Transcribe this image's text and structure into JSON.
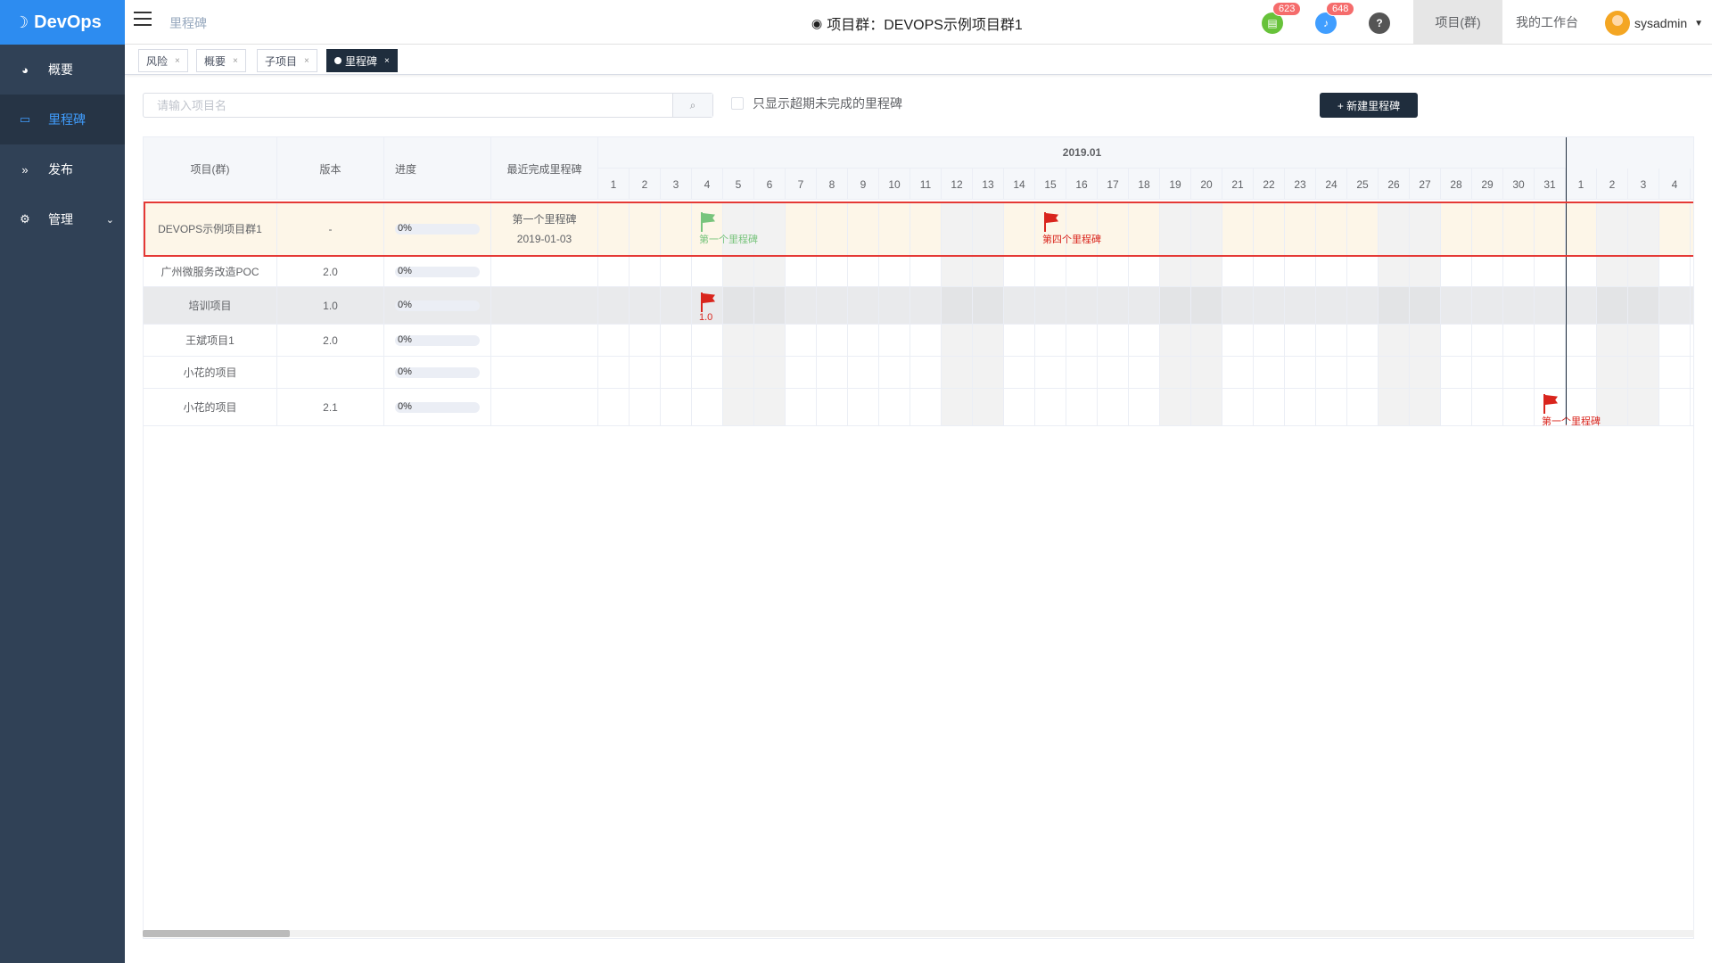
{
  "app": {
    "logo": "DevOps",
    "breadcrumb": "里程碑",
    "title": "项目群：DEVOPS示例项目群1",
    "user": "sysadmin"
  },
  "sidebar": {
    "items": [
      {
        "label": "概要",
        "icon": "dashboard-icon"
      },
      {
        "label": "里程碑",
        "icon": "folder-icon"
      },
      {
        "label": "发布",
        "icon": "forward-icon"
      },
      {
        "label": "管理",
        "icon": "gear-icon"
      }
    ]
  },
  "topbar": {
    "badge_tasks": "623",
    "badge_notify": "648",
    "nav_projects": "项目(群)",
    "nav_workspace": "我的工作台"
  },
  "tabs": [
    {
      "label": "风险"
    },
    {
      "label": "概要"
    },
    {
      "label": "子项目"
    },
    {
      "label": "里程碑"
    }
  ],
  "toolbar": {
    "search_placeholder": "请输入项目名",
    "overdue_only": "只显示超期未完成的里程碑",
    "new_button": "+ 新建里程碑"
  },
  "grid": {
    "headers": {
      "project": "项目(群)",
      "version": "版本",
      "progress": "进度",
      "latest": "最近完成里程碑"
    },
    "month": "2019.01",
    "days": [
      "1",
      "2",
      "3",
      "4",
      "5",
      "6",
      "7",
      "8",
      "9",
      "10",
      "11",
      "12",
      "13",
      "14",
      "15",
      "16",
      "17",
      "18",
      "19",
      "20",
      "21",
      "22",
      "23",
      "24",
      "25",
      "26",
      "27",
      "28",
      "29",
      "30",
      "31",
      "1",
      "2",
      "3",
      "4"
    ],
    "rows": [
      {
        "project": "DEVOPS示例项目群1",
        "version": "-",
        "progress": "0%",
        "latest_name": "第一个里程碑",
        "latest_date": "2019-01-03",
        "flags": [
          {
            "day": 4,
            "label": "第一个里程碑",
            "color": "green"
          },
          {
            "day": 15,
            "label": "第四个里程碑",
            "color": "red"
          }
        ]
      },
      {
        "project": "广州微服务改造POC",
        "version": "2.0",
        "progress": "0%",
        "latest_name": "",
        "latest_date": "",
        "flags": []
      },
      {
        "project": "培训项目",
        "version": "1.0",
        "progress": "0%",
        "latest_name": "",
        "latest_date": "",
        "flags": [
          {
            "day": 4,
            "label": "1.0",
            "color": "red"
          }
        ]
      },
      {
        "project": "王斌项目1",
        "version": "2.0",
        "progress": "0%",
        "latest_name": "",
        "latest_date": "",
        "flags": []
      },
      {
        "project": "小花的项目",
        "version": "",
        "progress": "0%",
        "latest_name": "",
        "latest_date": "",
        "flags": []
      },
      {
        "project": "小花的项目",
        "version": "2.1",
        "progress": "0%",
        "latest_name": "",
        "latest_date": "",
        "flags": [
          {
            "day": 31,
            "label": "第一个里程碑",
            "color": "red"
          }
        ]
      }
    ]
  }
}
